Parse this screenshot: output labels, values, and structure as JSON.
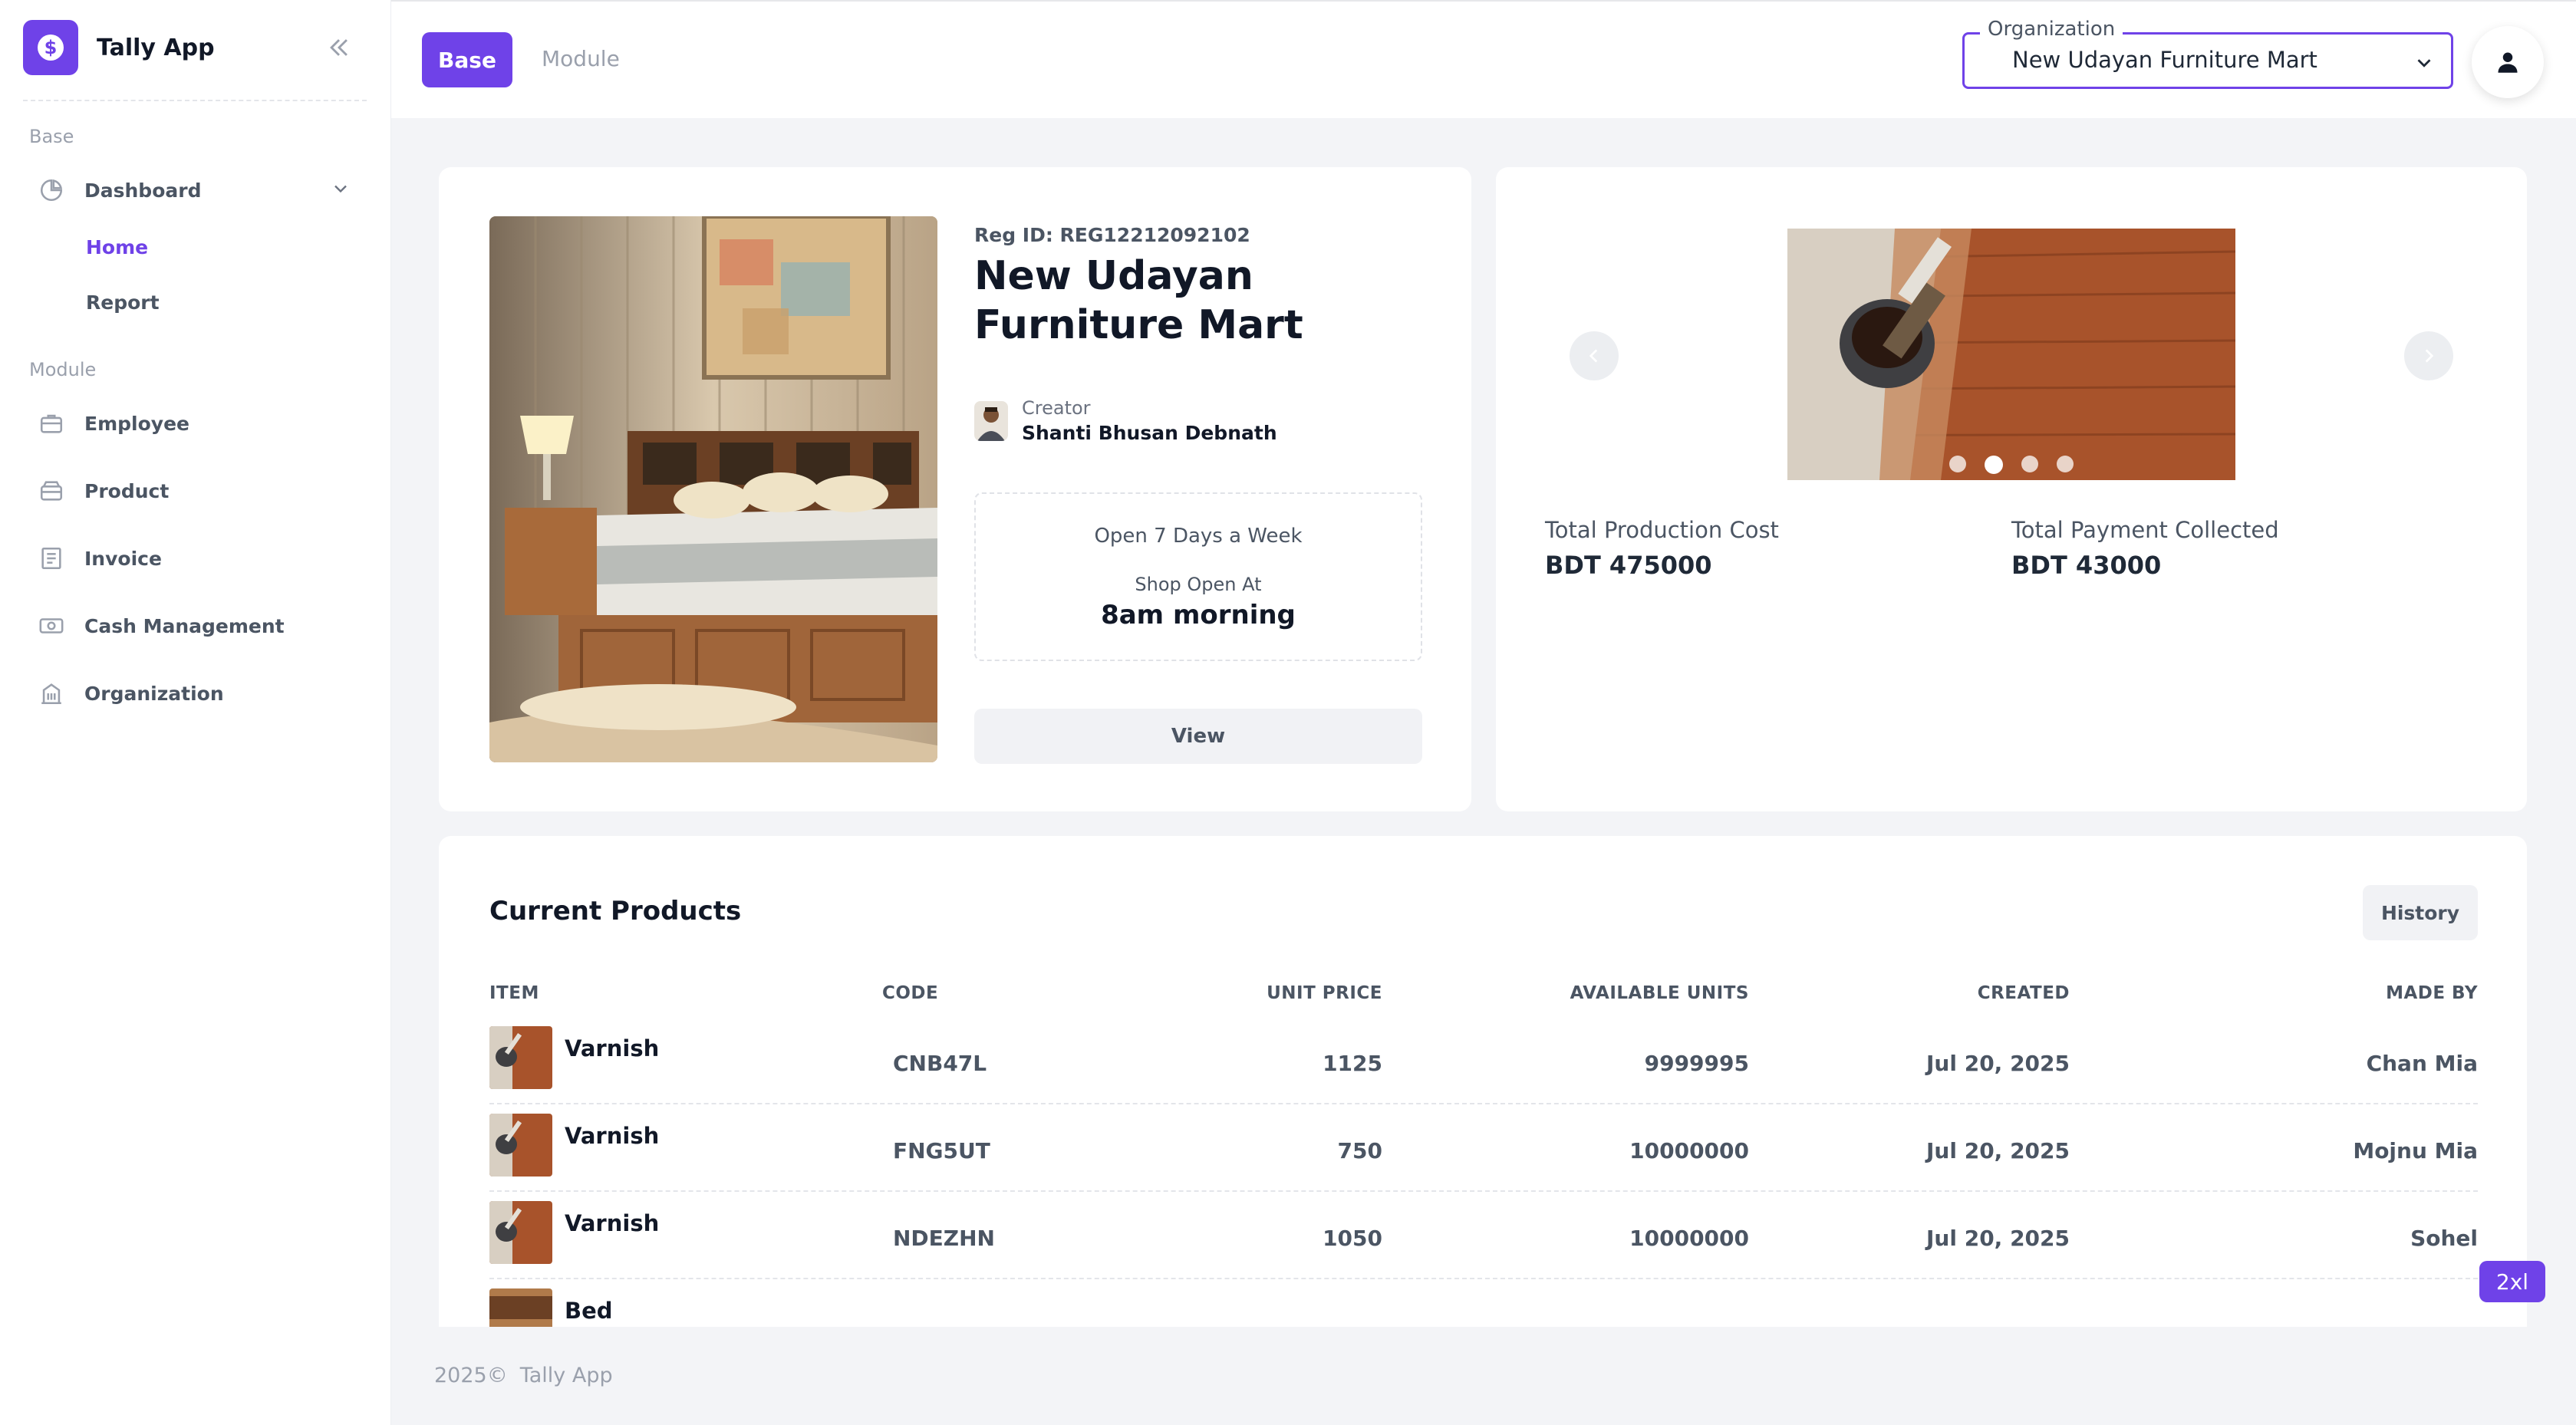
{
  "app": {
    "name": "Tally App"
  },
  "sidebar": {
    "sections": {
      "base": "Base",
      "module": "Module"
    },
    "dashboard": "Dashboard",
    "sub_items": [
      "Home",
      "Report"
    ],
    "module_items": [
      "Employee",
      "Product",
      "Invoice",
      "Cash Management",
      "Organization"
    ]
  },
  "header": {
    "tabs": [
      "Base",
      "Module"
    ],
    "org_label": "Organization",
    "org_value": "New Udayan Furniture Mart"
  },
  "shop": {
    "reg_id": "Reg ID: REG12212092102",
    "name": "New Udayan Furniture Mart",
    "creator_label": "Creator",
    "creator_name": "Shanti Bhusan Debnath",
    "open_days": "Open 7 Days a Week",
    "open_label": "Shop Open At",
    "open_time": "8am morning",
    "view_label": "View"
  },
  "stats": {
    "production_label": "Total Production Cost",
    "production_value": "BDT 475000",
    "payment_label": "Total Payment Collected",
    "payment_value": "BDT 43000",
    "carousel_slide_count": 4,
    "carousel_active_index": 1
  },
  "products": {
    "title": "Current Products",
    "history_label": "History",
    "columns": [
      "ITEM",
      "CODE",
      "UNIT PRICE",
      "AVAILABLE UNITS",
      "CREATED",
      "MADE BY"
    ],
    "rows": [
      {
        "item": "Varnish",
        "code": "CNB47L",
        "price": "1125",
        "units": "9999995",
        "created": "Jul 20, 2025",
        "made_by": "Chan Mia"
      },
      {
        "item": "Varnish",
        "code": "FNG5UT",
        "price": "750",
        "units": "10000000",
        "created": "Jul 20, 2025",
        "made_by": "Mojnu Mia"
      },
      {
        "item": "Varnish",
        "code": "NDEZHN",
        "price": "1050",
        "units": "10000000",
        "created": "Jul 20, 2025",
        "made_by": "Sohel"
      },
      {
        "item": "Bed",
        "code": "",
        "price": "",
        "units": "",
        "created": "",
        "made_by": ""
      }
    ]
  },
  "footer": {
    "year": "2025©",
    "name": "Tally App"
  },
  "breakpoint_badge": "2xl",
  "colors": {
    "accent": "#6f42e8",
    "background": "#f3f4f7",
    "card": "#ffffff",
    "text": "#1f2937",
    "muted": "#9aa0ac"
  },
  "icons": {
    "dashboard": "pie-chart-icon",
    "employee": "briefcase-icon",
    "product": "box-icon",
    "invoice": "receipt-icon",
    "cash": "banknote-icon",
    "organization": "building-icon",
    "collapse": "double-chevron-left-icon",
    "user": "user-icon"
  }
}
